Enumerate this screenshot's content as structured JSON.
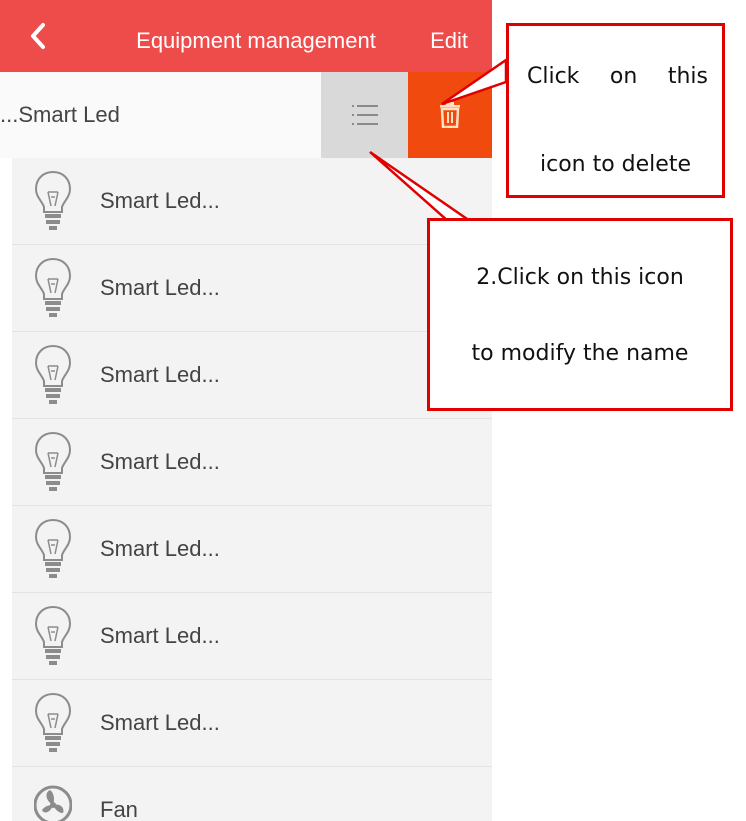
{
  "header": {
    "title": "Equipment management",
    "edit_label": "Edit",
    "accent_color": "#ee4b4b"
  },
  "swiped_item": {
    "name": "Smart Led...",
    "rename_icon": "list-icon",
    "delete_icon": "trash-icon",
    "delete_color": "#f04a0e"
  },
  "devices": [
    {
      "label": "Smart Led...",
      "icon": "bulb-icon"
    },
    {
      "label": "Smart Led...",
      "icon": "bulb-icon"
    },
    {
      "label": "Smart Led...",
      "icon": "bulb-icon"
    },
    {
      "label": "Smart Led...",
      "icon": "bulb-icon"
    },
    {
      "label": "Smart Led...",
      "icon": "bulb-icon"
    },
    {
      "label": "Smart Led...",
      "icon": "bulb-icon"
    },
    {
      "label": "Smart Led...",
      "icon": "bulb-icon"
    },
    {
      "label": "Fan",
      "icon": "fan-icon"
    }
  ],
  "annotations": {
    "delete_line1_words": [
      "Click",
      "on",
      "this"
    ],
    "delete_line2": "icon to delete",
    "rename_line1": "2.Click on this icon",
    "rename_line2": "to modify the name",
    "border_color": "#e00000"
  }
}
